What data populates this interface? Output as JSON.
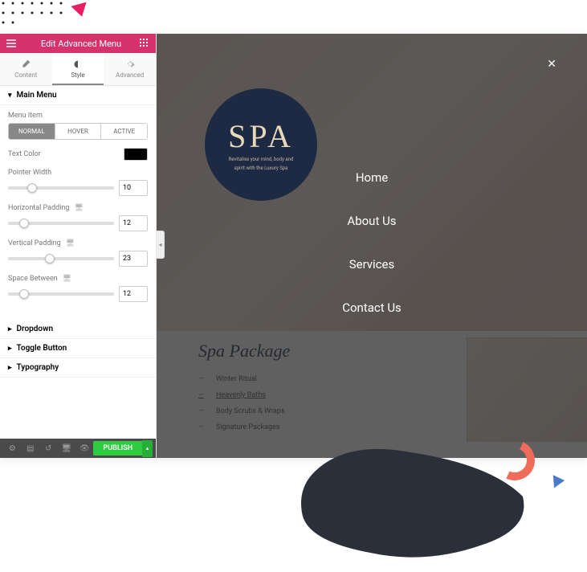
{
  "header": {
    "title": "Edit Advanced Menu"
  },
  "tabs": {
    "content": "Content",
    "style": "Style",
    "advanced": "Advanced"
  },
  "sections": {
    "main_menu": "Main Menu",
    "dropdown": "Dropdown",
    "toggle_button": "Toggle Button",
    "typography": "Typography"
  },
  "controls": {
    "menu_item_label": "Menu Item",
    "states": {
      "normal": "NORMAL",
      "hover": "HOVER",
      "active": "ACTIVE"
    },
    "text_color_label": "Text Color",
    "text_color_value": "#000000",
    "pointer_width": {
      "label": "Pointer Width",
      "value": "10"
    },
    "horizontal_padding": {
      "label": "Horizontal Padding",
      "value": "12"
    },
    "vertical_padding": {
      "label": "Vertical Padding",
      "value": "23"
    },
    "space_between": {
      "label": "Space Between",
      "value": "12"
    }
  },
  "footer": {
    "publish": "PUBLISH"
  },
  "preview": {
    "badge_big": "SPA",
    "badge_small1": "Revitalise your mind, body and",
    "badge_small2": "spirit with the Luxury Spa",
    "menu": [
      "Home",
      "About Us",
      "Services",
      "Contact Us"
    ],
    "package_title": "Spa Package",
    "package_items": [
      "Winter Ritual",
      "Heavenly Baths",
      "Body Scrubs & Wraps",
      "Signature Packages"
    ]
  }
}
